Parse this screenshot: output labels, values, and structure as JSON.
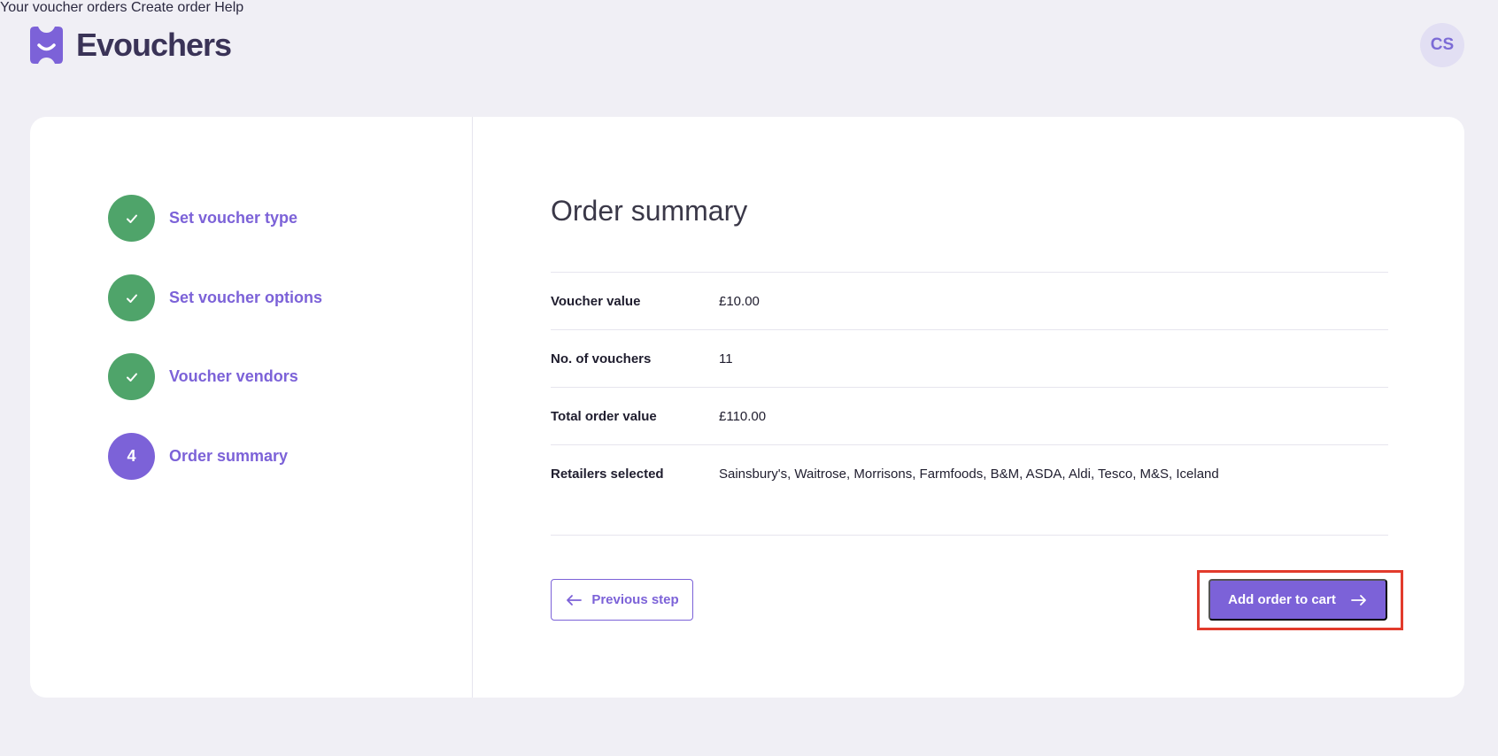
{
  "brand": {
    "name": "Evouchers",
    "accent": "#7c62d8",
    "success": "#4fa46a"
  },
  "nav": {
    "items": [
      {
        "label": "Your voucher orders"
      },
      {
        "label": "Create order"
      },
      {
        "label": "Help"
      }
    ],
    "avatar_initials": "CS"
  },
  "steps": [
    {
      "label": "Set voucher type",
      "state": "complete",
      "icon": "check-icon"
    },
    {
      "label": "Set voucher options",
      "state": "complete",
      "icon": "check-icon"
    },
    {
      "label": "Voucher vendors",
      "state": "complete",
      "icon": "check-icon"
    },
    {
      "label": "Order summary",
      "state": "current",
      "number": "4"
    }
  ],
  "summary": {
    "title": "Order summary",
    "rows": [
      {
        "label": "Voucher value",
        "value": "£10.00"
      },
      {
        "label": "No. of vouchers",
        "value": "11"
      },
      {
        "label": "Total order value",
        "value": "£110.00"
      },
      {
        "label": "Retailers selected",
        "value": "Sainsbury's, Waitrose, Morrisons, Farmfoods, B&M, ASDA, Aldi, Tesco, M&S, Iceland"
      }
    ]
  },
  "actions": {
    "previous_label": "Previous step",
    "add_label": "Add order to cart"
  }
}
